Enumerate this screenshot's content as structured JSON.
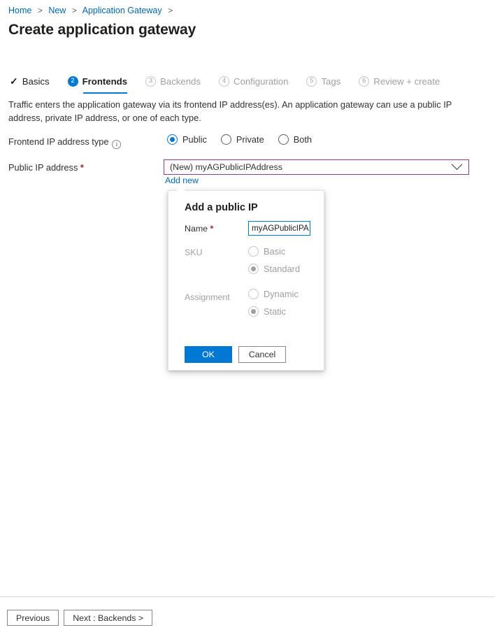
{
  "breadcrumb": {
    "items": [
      {
        "label": "Home"
      },
      {
        "label": "New"
      },
      {
        "label": "Application Gateway"
      }
    ],
    "separator": ">"
  },
  "page": {
    "title": "Create application gateway"
  },
  "steps": [
    {
      "badge": "✓",
      "label": "Basics",
      "state": "done"
    },
    {
      "badge": "2",
      "label": "Frontends",
      "state": "active"
    },
    {
      "badge": "3",
      "label": "Backends",
      "state": "todo"
    },
    {
      "badge": "4",
      "label": "Configuration",
      "state": "todo"
    },
    {
      "badge": "5",
      "label": "Tags",
      "state": "todo"
    },
    {
      "badge": "6",
      "label": "Review + create",
      "state": "todo"
    }
  ],
  "intro": {
    "text": "Traffic enters the application gateway via its frontend IP address(es). An application gateway can use a public IP address, private IP address, or one of each type."
  },
  "form": {
    "frontend_ip_type": {
      "label": "Frontend IP address type",
      "info_glyph": "i",
      "options": [
        {
          "label": "Public",
          "selected": true
        },
        {
          "label": "Private",
          "selected": false
        },
        {
          "label": "Both",
          "selected": false
        }
      ]
    },
    "public_ip": {
      "label": "Public IP address",
      "required_mark": "*",
      "value": "(New) myAGPublicIPAddress",
      "add_new_link": "Add new"
    }
  },
  "callout": {
    "title": "Add a public IP",
    "name": {
      "label": "Name",
      "required_mark": "*",
      "value_before_caret": "my",
      "value_after_caret": "AGPublicIPA"
    },
    "sku": {
      "label": "SKU",
      "options": [
        {
          "label": "Basic",
          "selected": false
        },
        {
          "label": "Standard",
          "selected": true
        }
      ]
    },
    "assignment": {
      "label": "Assignment",
      "options": [
        {
          "label": "Dynamic",
          "selected": false
        },
        {
          "label": "Static",
          "selected": true
        }
      ]
    },
    "ok_label": "OK",
    "cancel_label": "Cancel"
  },
  "footer": {
    "previous_label": "Previous",
    "next_label": "Next : Backends >"
  },
  "colors": {
    "accent": "#0078d4",
    "link": "#0067b8",
    "required": "#a4262c",
    "dropdown_border": "#8f3d8f",
    "disabled_text": "#a19f9d"
  }
}
